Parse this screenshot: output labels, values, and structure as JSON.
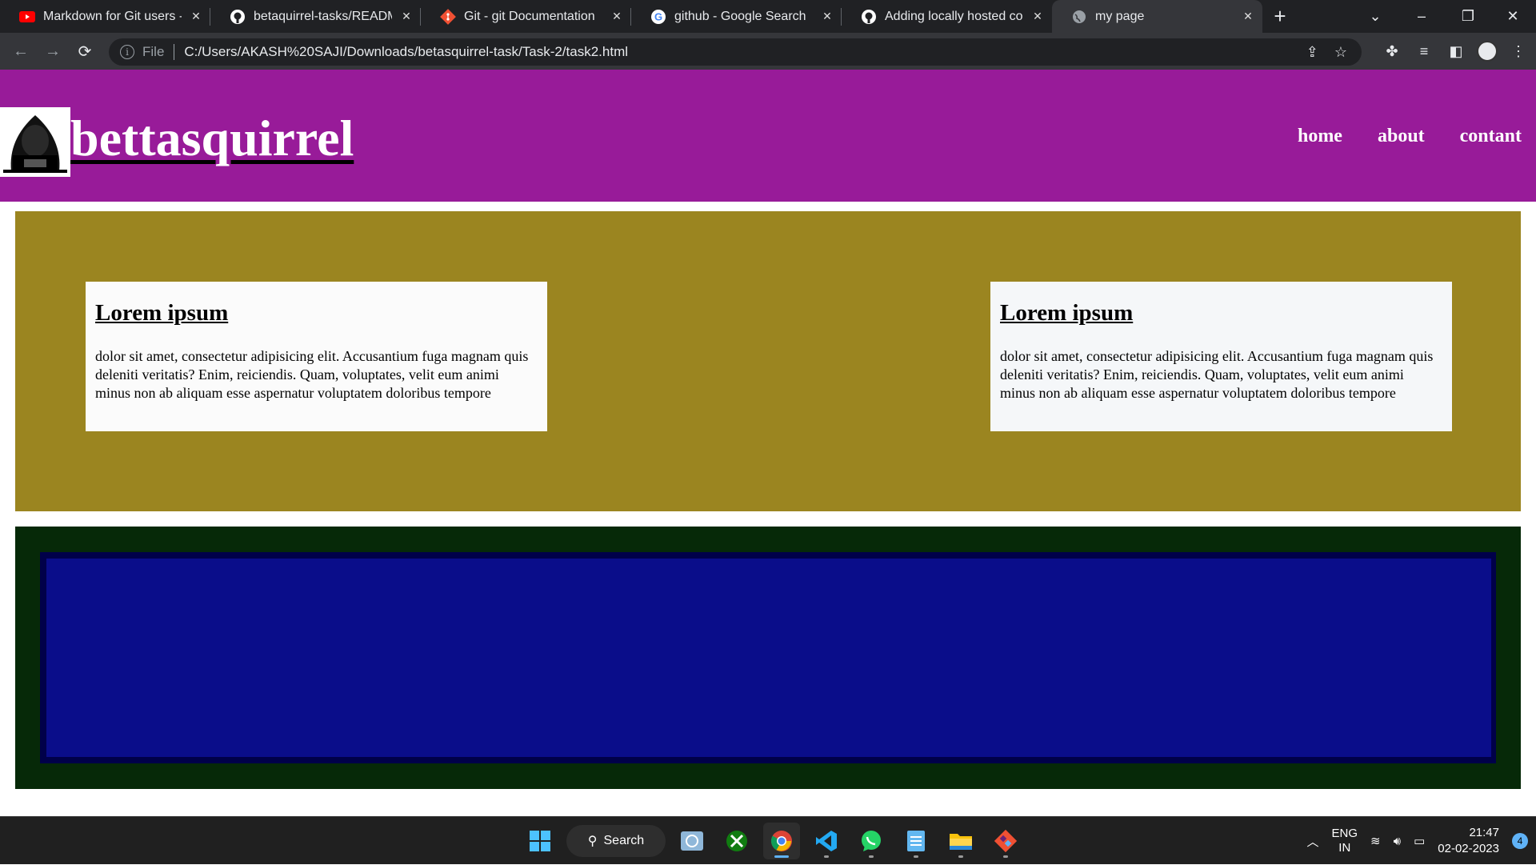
{
  "browser": {
    "tabs": [
      {
        "title": "Markdown for Git users - M",
        "icon": "youtube-icon"
      },
      {
        "title": "betaquirrel-tasks/README.",
        "icon": "github-icon"
      },
      {
        "title": "Git - git Documentation",
        "icon": "git-icon"
      },
      {
        "title": "github - Google Search",
        "icon": "google-icon"
      },
      {
        "title": "Adding locally hosted code",
        "icon": "github-icon"
      },
      {
        "title": "my page",
        "icon": "globe-icon",
        "active": true
      }
    ],
    "new_tab": "+",
    "address": {
      "scheme": "File",
      "url": "C:/Users/AKASH%20SAJI/Downloads/betasquirrel-task/Task-2/task2.html"
    }
  },
  "site": {
    "brand": "bettasquirrel",
    "nav": [
      "home",
      "about",
      "contant"
    ],
    "cards": [
      {
        "title": "Lorem ipsum",
        "body": "dolor sit amet, consectetur adipisicing elit. Accusantium fuga magnam quis deleniti veritatis? Enim, reiciendis. Quam, voluptates, velit eum animi minus non ab aliquam esse aspernatur voluptatem doloribus tempore"
      },
      {
        "title": "Lorem ipsum",
        "body": "dolor sit amet, consectetur adipisicing elit. Accusantium fuga magnam quis deleniti veritatis? Enim, reiciendis. Quam, voluptates, velit eum animi minus non ab aliquam esse aspernatur voluptatem doloribus tempore"
      }
    ],
    "colors": {
      "header": "#981b99",
      "section1": "#9b8520",
      "section2": "#062908",
      "inner_frame": "#000049",
      "inner_blue": "#0a0d8a",
      "card1": "#fbfbfb",
      "card2": "#f5f7f9"
    }
  },
  "taskbar": {
    "search_label": "Search",
    "apps": [
      "windows-start-icon",
      "search-icon",
      "photos-icon",
      "xbox-icon",
      "chrome-icon",
      "vscode-icon",
      "whatsapp-icon",
      "notepad-icon",
      "file-explorer-icon",
      "git-icon"
    ],
    "lang_line1": "ENG",
    "lang_line2": "IN",
    "time": "21:47",
    "date": "02-02-2023",
    "notifications": "4"
  }
}
